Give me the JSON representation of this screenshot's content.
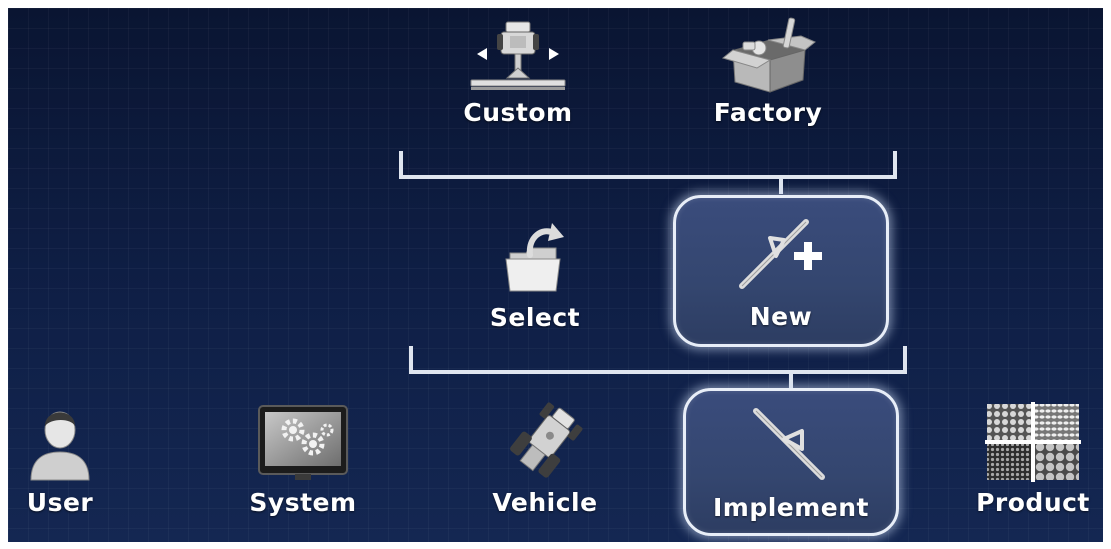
{
  "top_row": {
    "custom": {
      "label": "Custom",
      "icon": "tractor-custom-icon"
    },
    "factory": {
      "label": "Factory",
      "icon": "factory-box-icon"
    }
  },
  "middle_row": {
    "select": {
      "label": "Select",
      "icon": "folder-open-icon"
    },
    "new": {
      "label": "New",
      "icon": "implement-add-icon",
      "selected": true
    }
  },
  "bottom_row": {
    "user": {
      "label": "User",
      "icon": "user-avatar-icon"
    },
    "system": {
      "label": "System",
      "icon": "system-gears-icon"
    },
    "vehicle": {
      "label": "Vehicle",
      "icon": "vehicle-icon"
    },
    "implement": {
      "label": "Implement",
      "icon": "implement-icon",
      "selected": true
    },
    "product": {
      "label": "Product",
      "icon": "product-seeds-icon"
    }
  },
  "colors": {
    "background": "#0e1d40",
    "selected_fill": "#34466f",
    "selected_border": "#e8eef8",
    "connector": "#dfe5ef",
    "text": "#ffffff"
  }
}
